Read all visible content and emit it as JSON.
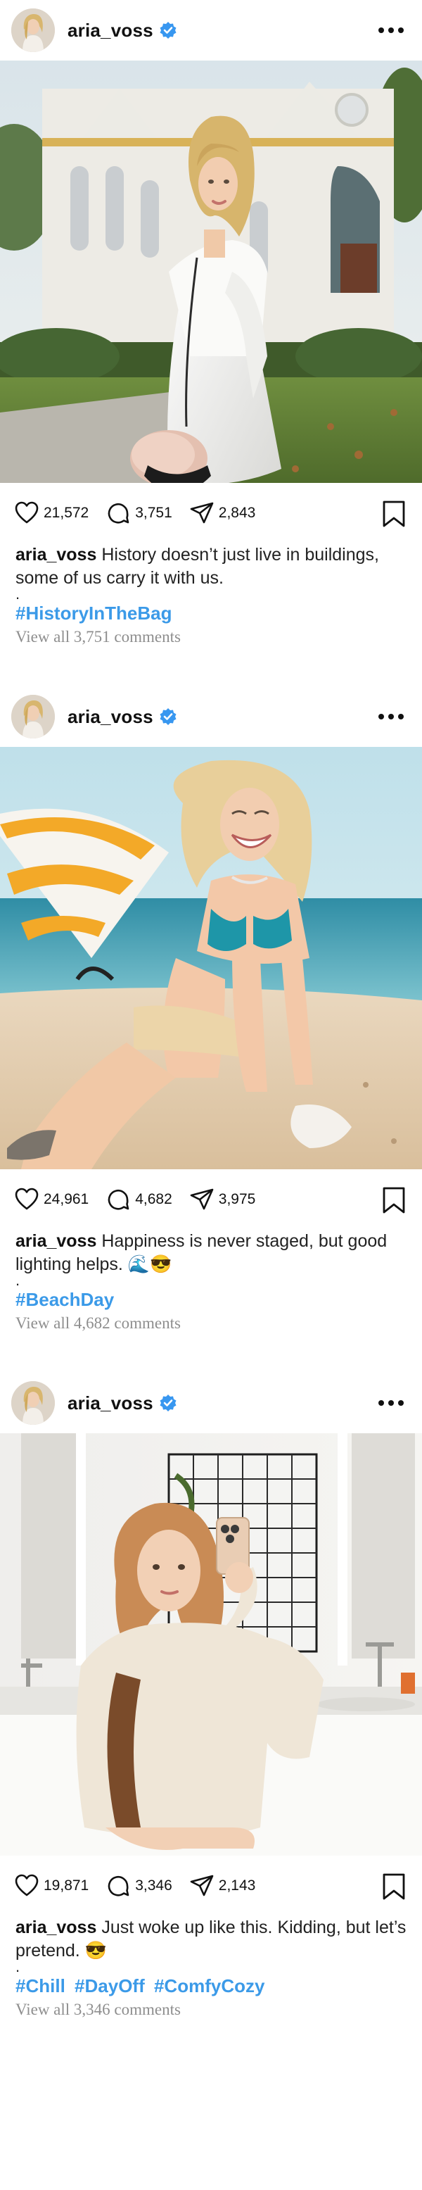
{
  "posts": [
    {
      "username": "aria_voss",
      "likes": "21,572",
      "comments": "3,751",
      "shares": "2,843",
      "caption": "History doesn’t just live in buildings, some of us carry it with us.",
      "caption_dot": ".",
      "hashtags": [
        "#HistoryInTheBag"
      ],
      "view_comments": "View all 3,751 comments",
      "photo_subject": "woman in white dress with fluffy handbag in front of white gothic church"
    },
    {
      "username": "aria_voss",
      "likes": "24,961",
      "comments": "4,682",
      "shares": "3,975",
      "caption": "Happiness is never staged, but good lighting helps. 🌊😎",
      "caption_dot": ".",
      "hashtags": [
        "#BeachDay"
      ],
      "view_comments": "View all 4,682 comments",
      "photo_subject": "smiling woman in teal bikini kneeling on beach sand with striped umbrella"
    },
    {
      "username": "aria_voss",
      "likes": "19,871",
      "comments": "3,346",
      "shares": "2,143",
      "caption": "Just woke up like this. Kidding, but let’s pretend. 😎",
      "caption_dot": ".",
      "hashtags": [
        "#Chill",
        "#DayOff",
        "#ComfyCozy"
      ],
      "view_comments": "View all 3,346 comments",
      "photo_subject": "woman in cream sweater taking mirror selfie in bathroom"
    }
  ],
  "icons": {
    "verified": "verified-badge-icon",
    "more": "more-options-icon",
    "like": "heart-icon",
    "comment": "comment-bubble-icon",
    "share": "send-icon",
    "save": "bookmark-icon"
  },
  "colors": {
    "verified_blue": "#3897f0",
    "hashtag_blue": "#3b9ae8",
    "muted_gray": "#8e8e8e"
  }
}
